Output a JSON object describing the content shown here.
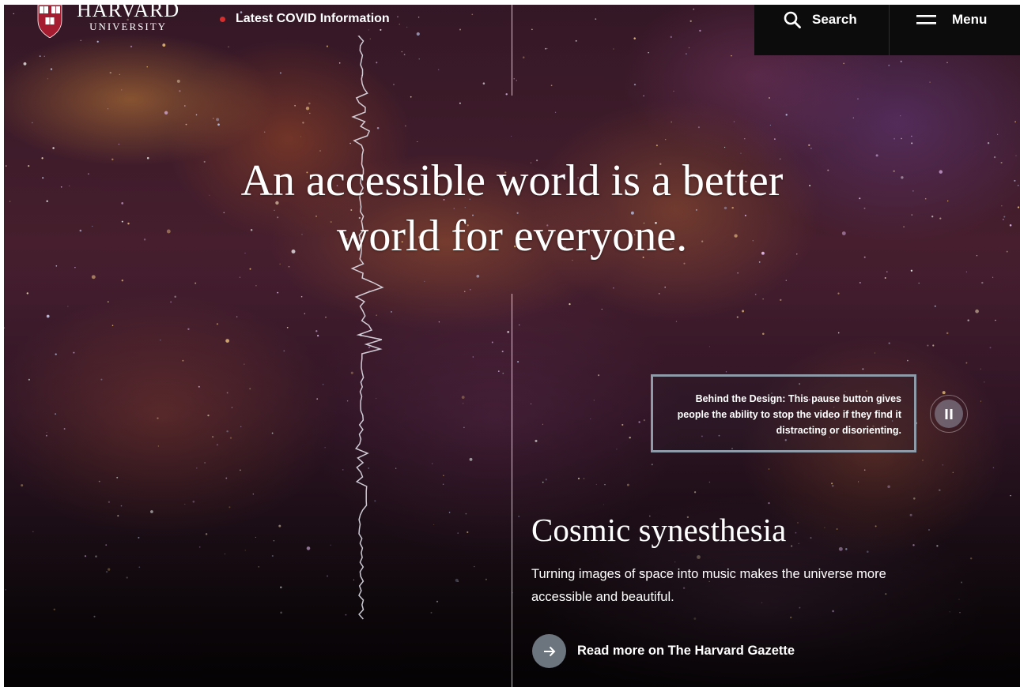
{
  "header": {
    "logo_name": "HARVARD",
    "logo_sub": "UNIVERSITY",
    "shield_motto": "VE RI TAS",
    "covid_link": "Latest COVID Information",
    "search_label": "Search",
    "menu_label": "Menu"
  },
  "hero": {
    "headline_line1": "An accessible world is a better",
    "headline_line2": "world for everyone.",
    "design_note": "Behind the Design: This pause button gives people the ability to stop the video if they find it distracting or disorienting."
  },
  "story": {
    "title": "Cosmic synesthesia",
    "description": "Turning images of space into music makes the universe more accessible and beautiful.",
    "cta": "Read more on The Harvard Gazette"
  },
  "icons": {
    "search": "search-icon",
    "menu": "menu-icon",
    "pause": "pause-icon",
    "arrow": "arrow-right-icon",
    "shield": "harvard-shield-icon"
  },
  "colors": {
    "covid_dot": "#d62d2d",
    "topbar_bg": "#0c0c0c",
    "design_note_border": "#8f9ba8",
    "cta_circle": "#6c747d"
  }
}
